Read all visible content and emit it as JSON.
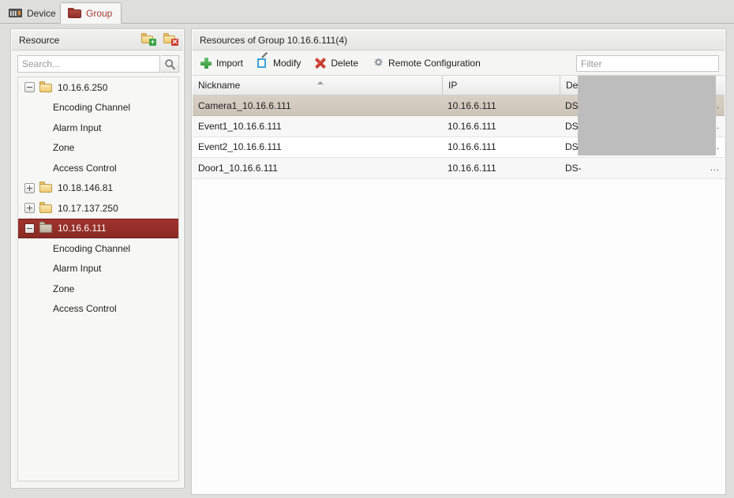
{
  "window": {
    "background_color": "#dededd"
  },
  "tabs": [
    {
      "id": "device",
      "label": "Device",
      "icon": "device-icon",
      "active": false
    },
    {
      "id": "group",
      "label": "Group",
      "icon": "folder-red-icon",
      "active": true
    }
  ],
  "left_panel": {
    "title": "Resource",
    "actions": [
      {
        "id": "add-group",
        "icon": "folder-add-icon",
        "badge": "+"
      },
      {
        "id": "delete-group",
        "icon": "folder-delete-icon",
        "badge": "✕"
      }
    ],
    "search": {
      "placeholder": "Search...",
      "value": "",
      "button_icon": "search-icon"
    },
    "tree": [
      {
        "label": "10.16.6.250",
        "type": "group",
        "expander": "minus",
        "selected": false,
        "indent": 0
      },
      {
        "label": "Encoding Channel",
        "type": "leaf",
        "selected": false,
        "indent": 1
      },
      {
        "label": "Alarm Input",
        "type": "leaf",
        "selected": false,
        "indent": 1
      },
      {
        "label": "Zone",
        "type": "leaf",
        "selected": false,
        "indent": 1
      },
      {
        "label": "Access Control",
        "type": "leaf",
        "selected": false,
        "indent": 1
      },
      {
        "label": "10.18.146.81",
        "type": "group",
        "expander": "plus",
        "selected": false,
        "indent": 0
      },
      {
        "label": "10.17.137.250",
        "type": "group",
        "expander": "plus",
        "selected": false,
        "indent": 0
      },
      {
        "label": "10.16.6.111",
        "type": "group",
        "expander": "minus",
        "selected": true,
        "indent": 0
      },
      {
        "label": "Encoding Channel",
        "type": "leaf",
        "selected": false,
        "indent": 1
      },
      {
        "label": "Alarm Input",
        "type": "leaf",
        "selected": false,
        "indent": 1
      },
      {
        "label": "Zone",
        "type": "leaf",
        "selected": false,
        "indent": 1
      },
      {
        "label": "Access Control",
        "type": "leaf",
        "selected": false,
        "indent": 1
      }
    ]
  },
  "right_panel": {
    "title": "Resources of Group 10.16.6.111(4)",
    "toolbar": [
      {
        "id": "import",
        "label": "Import",
        "icon": "plus-green-icon"
      },
      {
        "id": "modify",
        "label": "Modify",
        "icon": "edit-document-icon"
      },
      {
        "id": "delete",
        "label": "Delete",
        "icon": "x-red-icon"
      },
      {
        "id": "remote-configuration",
        "label": "Remote Configuration",
        "icon": "gear-icon"
      }
    ],
    "filter": {
      "placeholder": "Filter",
      "value": ""
    },
    "table": {
      "columns": [
        {
          "id": "nickname",
          "label": "Nickname",
          "sort": "asc"
        },
        {
          "id": "ip",
          "label": "IP",
          "sort": null
        },
        {
          "id": "serial",
          "label": "Device Serial No.",
          "sort": null
        }
      ],
      "rows": [
        {
          "nickname": "Camera1_10.16.6.111",
          "ip": "10.16.6.111",
          "serial": "DS-",
          "overflow": "...",
          "selected": true
        },
        {
          "nickname": "Event1_10.16.6.111",
          "ip": "10.16.6.111",
          "serial": "DS-",
          "overflow": "...",
          "selected": false
        },
        {
          "nickname": "Event2_10.16.6.111",
          "ip": "10.16.6.111",
          "serial": "DS-",
          "overflow": "...",
          "selected": false
        },
        {
          "nickname": "Door1_10.16.6.111",
          "ip": "10.16.6.111",
          "serial": "DS-",
          "overflow": "...",
          "selected": false
        }
      ]
    }
  },
  "colors": {
    "accent_red": "#9f332c",
    "tab_active_text": "#a33d36",
    "selected_row": "#d8d0c6",
    "panel_bg": "#f5f5f4",
    "redaction": "#bdbdbd"
  }
}
